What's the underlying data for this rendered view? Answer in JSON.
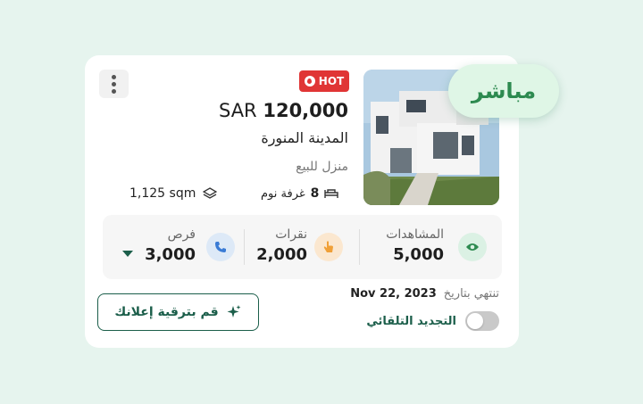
{
  "listing": {
    "badge_hot": "HOT",
    "price_currency": "SAR",
    "price_amount": "120,000",
    "city": "المدينة المنورة",
    "property_type": "منزل للبيع",
    "rooms_count": "8",
    "rooms_label": "غرفة نوم",
    "area": "1,125 sqm",
    "status_badge": "مباشر"
  },
  "stats": {
    "views": {
      "label": "المشاهدات",
      "value": "5,000",
      "icon": "eye-icon"
    },
    "clicks": {
      "label": "نقرات",
      "value": "2,000",
      "icon": "tap-hand-icon"
    },
    "leads": {
      "label": "فرص",
      "value": "3,000",
      "icon": "phone-icon"
    }
  },
  "footer": {
    "expires_label": "تنتهي بتاريخ",
    "expires_date": "Nov 22, 2023",
    "auto_renew_label": "التجديد التلقائي",
    "auto_renew_on": false,
    "promote_label": "قم بترقية إعلانك"
  },
  "colors": {
    "brand": "#1b5e4a",
    "live_green": "#2d8a50",
    "hot_red": "#e03535",
    "background": "#e6f4ee"
  }
}
